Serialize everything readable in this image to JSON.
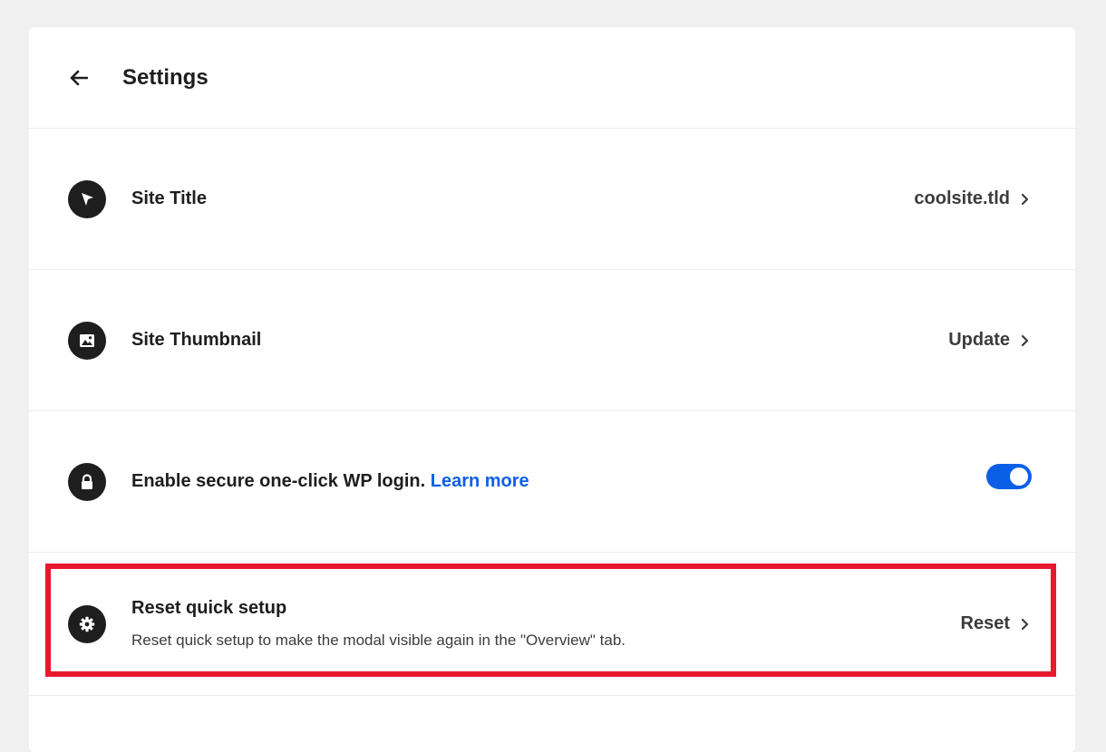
{
  "header": {
    "title": "Settings"
  },
  "rows": {
    "site_title": {
      "label": "Site Title",
      "value": "coolsite.tld",
      "icon": "cursor-arrow-icon"
    },
    "site_thumbnail": {
      "label": "Site Thumbnail",
      "value": "Update",
      "icon": "image-icon"
    },
    "secure_login": {
      "label": "Enable secure one-click WP login.",
      "link": "Learn more",
      "enabled": true,
      "icon": "lock-icon"
    },
    "reset_setup": {
      "label": "Reset quick setup",
      "description": "Reset quick setup to make the modal visible again in the \"Overview\" tab.",
      "action": "Reset",
      "icon": "gear-icon"
    }
  },
  "colors": {
    "accent": "#0b5fe6",
    "highlight": "#e8192c",
    "icon_bg": "#1e1e1e"
  }
}
